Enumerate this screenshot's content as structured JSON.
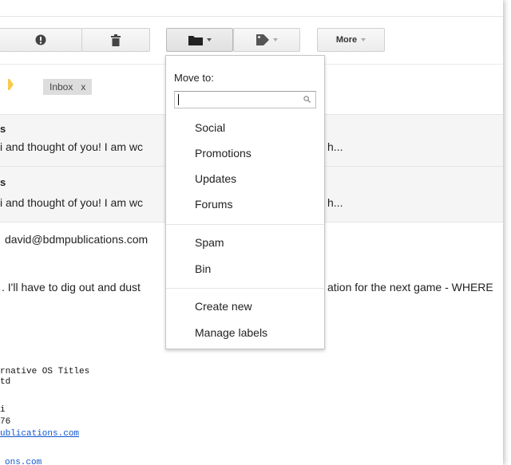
{
  "toolbar": {
    "report_spam_icon": "exclamation-icon",
    "delete_icon": "trash-icon",
    "move_to_icon": "folder-icon",
    "labels_icon": "tag-icon",
    "more_label": "More"
  },
  "label_chip": {
    "name": "Inbox",
    "remove": "x"
  },
  "messages": [
    {
      "sender": "s",
      "snippet": "i and thought of you! I am wc",
      "snippet_tail": "h..."
    },
    {
      "sender": "s",
      "snippet": "i and thought of you! I am wc",
      "snippet_tail": "h..."
    }
  ],
  "message_body": {
    "email_line": "david@bdmpublications.com",
    "body_left": ". I'll have to dig out and dust",
    "body_right": "ation for the next game - WHERE",
    "signature": [
      "rnative OS Titles",
      "td",
      "i",
      "76"
    ],
    "link_1": "ublications.com",
    "link_2": "ons.com"
  },
  "move_menu": {
    "title": "Move to:",
    "search_placeholder": "",
    "search_icon": "search-icon",
    "group_categories": [
      "Social",
      "Promotions",
      "Updates",
      "Forums"
    ],
    "group_system": [
      "Spam",
      "Bin"
    ],
    "group_actions": [
      "Create new",
      "Manage labels"
    ]
  },
  "colors": {
    "label_tag": "#f7cb4d",
    "link": "#1155cc",
    "message_bg": "#f5f5f5"
  }
}
